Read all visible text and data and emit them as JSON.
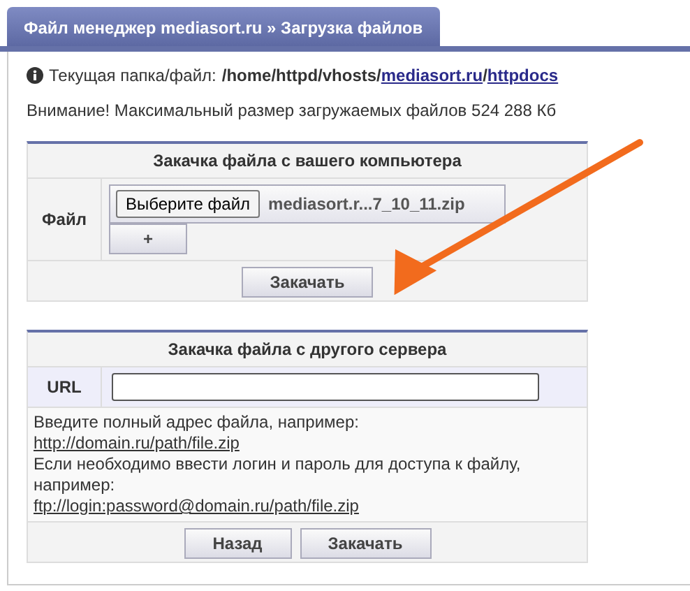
{
  "tab": {
    "title": "Файл менеджер mediasort.ru » Загрузка файлов"
  },
  "current": {
    "label": "Текущая папка/файл:",
    "path": [
      {
        "kind": "text",
        "text": "/home/httpd/vhosts/"
      },
      {
        "kind": "link",
        "text": "mediasort.ru"
      },
      {
        "kind": "text",
        "text": "/"
      },
      {
        "kind": "link",
        "text": "httpdocs"
      }
    ]
  },
  "notice": "Внимание! Максимальный размер загружаемых файлов 524 288 Кб",
  "local_upload": {
    "title": "Закачка файла с вашего компьютера",
    "field_label": "Файл",
    "choose_button": "Выберите файл",
    "file_name": "mediasort.r...7_10_11.zip",
    "add_button": "+",
    "submit_button": "Закачать"
  },
  "remote_upload": {
    "title": "Закачка файла с другого сервера",
    "field_label": "URL",
    "help": [
      {
        "kind": "text",
        "text": "Введите полный адрес файла, например:"
      },
      {
        "kind": "link",
        "text": "http://domain.ru/path/file.zip"
      },
      {
        "kind": "text",
        "text": "Если необходимо ввести логин и пароль для доступа к файлу, например:"
      },
      {
        "kind": "link",
        "text": "ftp://login:password@domain.ru/path/file.zip"
      }
    ],
    "back_button": "Назад",
    "submit_button": "Закачать"
  }
}
